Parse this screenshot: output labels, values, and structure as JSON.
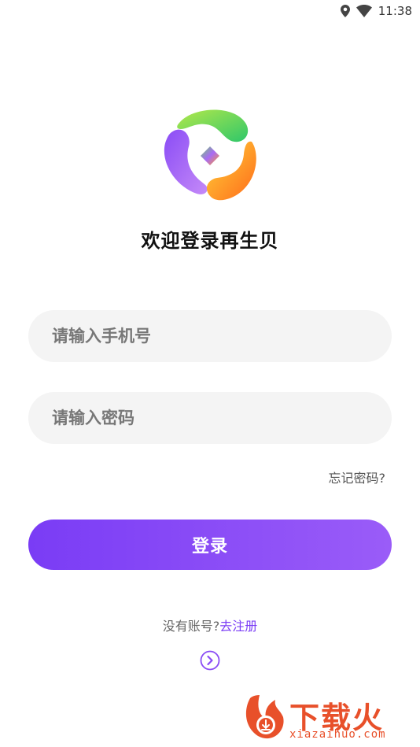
{
  "status_bar": {
    "time": "11:38",
    "icons": [
      "location-icon",
      "wifi-icon"
    ]
  },
  "app": {
    "logo": "app-logo",
    "welcome_title": "欢迎登录再生贝"
  },
  "form": {
    "phone_placeholder": "请输入手机号",
    "phone_value": "",
    "password_placeholder": "请输入密码",
    "password_value": "",
    "forgot_label": "忘记密码?",
    "login_label": "登录"
  },
  "register": {
    "prompt": "没有账号?",
    "link_label": "去注册"
  },
  "watermark": {
    "title": "下载火",
    "subtitle": "xiazaihuo.com"
  },
  "colors": {
    "accent": "#7a3cf5",
    "accent_end": "#9a5cf8",
    "field_bg": "#f4f4f4",
    "watermark": "#e8502a"
  }
}
